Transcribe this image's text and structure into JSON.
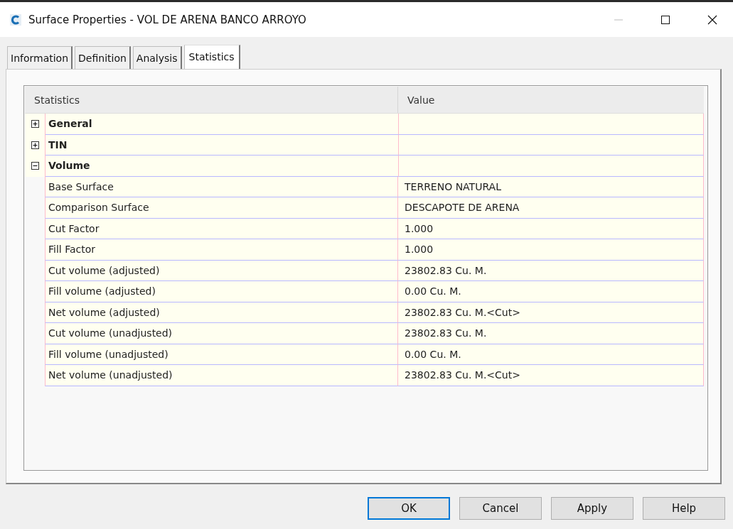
{
  "window": {
    "title": "Surface Properties - VOL DE ARENA BANCO ARROYO"
  },
  "tabs": [
    {
      "label": "Information",
      "selected": false
    },
    {
      "label": "Definition",
      "selected": false
    },
    {
      "label": "Analysis",
      "selected": false
    },
    {
      "label": "Statistics",
      "selected": true
    }
  ],
  "grid": {
    "columns": [
      "Statistics",
      "Value"
    ],
    "rows": [
      {
        "label": "General",
        "value": "",
        "expanded": false
      },
      {
        "label": "TIN",
        "value": "",
        "expanded": false
      },
      {
        "label": "Volume",
        "value": "",
        "expanded": true,
        "children": [
          {
            "label": "Base Surface",
            "value": "TERRENO NATURAL"
          },
          {
            "label": "Comparison Surface",
            "value": "DESCAPOTE DE ARENA"
          },
          {
            "label": "Cut Factor",
            "value": "1.000"
          },
          {
            "label": "Fill Factor",
            "value": "1.000"
          },
          {
            "label": "Cut volume (adjusted)",
            "value": "23802.83 Cu. M."
          },
          {
            "label": "Fill volume (adjusted)",
            "value": "0.00 Cu. M."
          },
          {
            "label": "Net volume (adjusted)",
            "value": "23802.83 Cu. M.<Cut>"
          },
          {
            "label": "Cut volume (unadjusted)",
            "value": "23802.83 Cu. M."
          },
          {
            "label": "Fill volume (unadjusted)",
            "value": "0.00 Cu. M."
          },
          {
            "label": "Net volume (unadjusted)",
            "value": "23802.83 Cu. M.<Cut>"
          }
        ]
      }
    ]
  },
  "buttons": [
    {
      "label": "OK",
      "focused": true
    },
    {
      "label": "Cancel",
      "focused": false
    },
    {
      "label": "Apply",
      "focused": false
    },
    {
      "label": "Help",
      "focused": false
    }
  ]
}
